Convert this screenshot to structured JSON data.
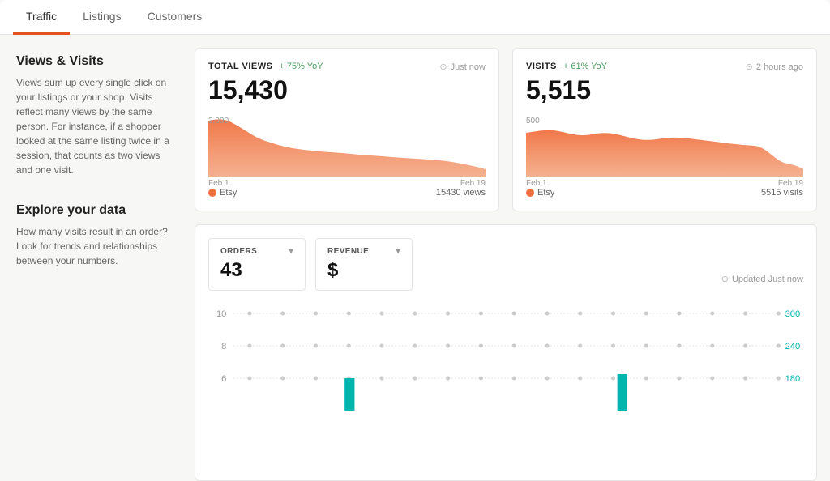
{
  "tabs": [
    {
      "id": "traffic",
      "label": "Traffic",
      "active": true
    },
    {
      "id": "listings",
      "label": "Listings",
      "active": false
    },
    {
      "id": "customers",
      "label": "Customers",
      "active": false
    }
  ],
  "views_visits_section": {
    "sidebar_title": "Views & Visits",
    "sidebar_desc": "Views sum up every single click on your listings or your shop. Visits reflect many views by the same person. For instance, if a shopper looked at the same listing twice in a session, that counts as two views and one visit."
  },
  "total_views": {
    "title": "TOTAL VIEWS",
    "yoy": "+ 75% YoY",
    "timestamp": "Just now",
    "value": "15,430",
    "chart_max": "2,000",
    "date_start": "Feb 1",
    "date_end": "Feb 19",
    "legend": "Etsy",
    "legend_count": "15430 views",
    "dot_color": "#f07040"
  },
  "visits": {
    "title": "VISITS",
    "yoy": "+ 61% YoY",
    "timestamp": "2 hours ago",
    "value": "5,515",
    "chart_max": "500",
    "date_start": "Feb 1",
    "date_end": "Feb 19",
    "legend": "Etsy",
    "legend_count": "5515 visits",
    "dot_color": "#f07040"
  },
  "explore_section": {
    "sidebar_title": "Explore your data",
    "sidebar_desc": "How many visits result in an order? Look for trends and relationships between your numbers."
  },
  "orders": {
    "label": "ORDERS",
    "value": "43"
  },
  "revenue": {
    "label": "REVENUE",
    "value": "$"
  },
  "updated": "Updated Just now",
  "chart_y_left": [
    "10",
    "8",
    "6"
  ],
  "chart_y_right": [
    "300",
    "240",
    "180"
  ],
  "accent_color": "#e2521d",
  "teal_color": "#00b5ad",
  "orange_color": "#f07040"
}
